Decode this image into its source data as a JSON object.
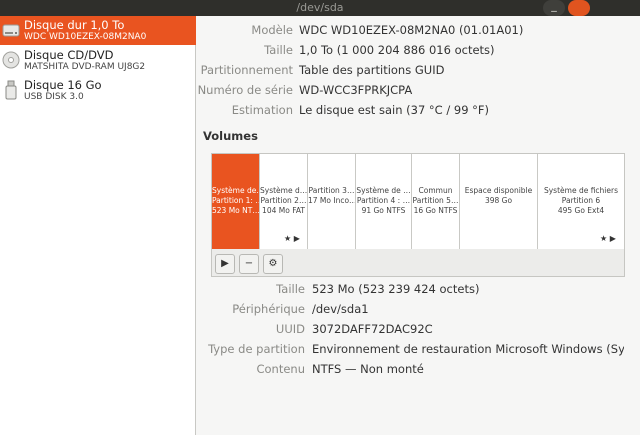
{
  "window": {
    "title": "/dev/sda"
  },
  "sidebar": {
    "devices": [
      {
        "name": "Disque dur 1,0 To",
        "detail": "WDC WD10EZEX-08M2NA0",
        "icon": "hard-disk-icon",
        "selected": true
      },
      {
        "name": "Disque CD/DVD",
        "detail": "MATSHITA DVD-RAM UJ8G2",
        "icon": "optical-disc-icon",
        "selected": false
      },
      {
        "name": "Disque 16 Go",
        "detail": "USB DISK 3.0",
        "icon": "usb-drive-icon",
        "selected": false
      }
    ]
  },
  "drive": {
    "model_label": "Modèle",
    "model": "WDC WD10EZEX-08M2NA0 (01.01A01)",
    "size_label": "Taille",
    "size": "1,0 To (1 000 204 886 016 octets)",
    "partitioning_label": "Partitionnement",
    "partitioning": "Table des partitions GUID",
    "serial_label": "Numéro de série",
    "serial": "WD-WCC3FPRKJCPA",
    "assessment_label": "Estimation",
    "assessment": "Le disque est sain (37 °C / 99 °F)"
  },
  "volumes": {
    "title": "Volumes",
    "partitions": [
      {
        "l1": "Système de…",
        "l2": "Partition 1: …",
        "l3": "523 Mo NT…",
        "selected": true,
        "markers": ""
      },
      {
        "l1": "Système d…",
        "l2": "Partition 2…",
        "l3": "104 Mo FAT",
        "selected": false,
        "markers": "★ ▶"
      },
      {
        "l1": "Partition 3…",
        "l2": "17 Mo Inco…",
        "l3": "",
        "selected": false,
        "markers": ""
      },
      {
        "l1": "Système de …",
        "l2": "Partition 4 : …",
        "l3": "91 Go NTFS",
        "selected": false,
        "markers": ""
      },
      {
        "l1": "Commun",
        "l2": "Partition 5…",
        "l3": "16 Go NTFS",
        "selected": false,
        "markers": ""
      },
      {
        "l1": "Espace disponible",
        "l2": "398 Go",
        "l3": "",
        "selected": false,
        "markers": ""
      },
      {
        "l1": "Système de fichiers",
        "l2": "Partition 6",
        "l3": "495 Go Ext4",
        "selected": false,
        "markers": "★ ▶"
      }
    ],
    "toolbar": {
      "play": "▶",
      "minus": "−",
      "settings": "⚙"
    }
  },
  "details": {
    "size_label": "Taille",
    "size": "523 Mo (523 239 424 octets)",
    "device_label": "Périphérique",
    "device": "/dev/sda1",
    "uuid_label": "UUID",
    "uuid": "3072DAFF72DAC92C",
    "type_label": "Type de partition",
    "type": "Environnement de restauration Microsoft Windows (Sys…",
    "content_label": "Contenu",
    "content": "NTFS — Non monté"
  }
}
